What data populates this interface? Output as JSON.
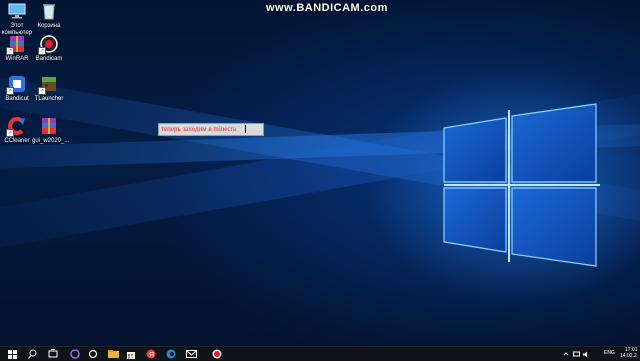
{
  "watermark": "www.BANDICAM.com",
  "desktop_icons": [
    {
      "id": "this-pc",
      "label": "Этот\nкомпьютер",
      "icon": "monitor-icon"
    },
    {
      "id": "recycle-bin",
      "label": "Корзина",
      "icon": "recycle-bin-icon"
    },
    {
      "id": "winrar",
      "label": "WinRAR",
      "icon": "winrar-icon"
    },
    {
      "id": "bandicam",
      "label": "Bandicam",
      "icon": "bandicam-icon"
    },
    {
      "id": "bandicut",
      "label": "Bandicut",
      "icon": "bandicut-icon"
    },
    {
      "id": "tlauncher",
      "label": "TLauncher",
      "icon": "tlauncher-icon"
    },
    {
      "id": "ccleaner",
      "label": "CCleaner",
      "icon": "ccleaner-icon"
    },
    {
      "id": "gui-archive",
      "label": "gui_w2020_...",
      "icon": "archive-icon"
    }
  ],
  "textbox": {
    "text": "теперь заходим в minecra"
  },
  "taskbar": {
    "icons": [
      "windows-start-icon",
      "search-icon",
      "task-view-icon",
      "alice-voice-icon",
      "cortana-icon",
      "file-explorer-icon",
      "store-icon",
      "yandex-browser-icon",
      "edge-icon",
      "mail-icon",
      "bandicam-record-icon"
    ],
    "language": "ENG",
    "time": "17:01",
    "date": "14.02.2"
  },
  "colors": {
    "accent": "#1f7bff",
    "text_red": "#e02020",
    "taskbar": "#101318"
  }
}
